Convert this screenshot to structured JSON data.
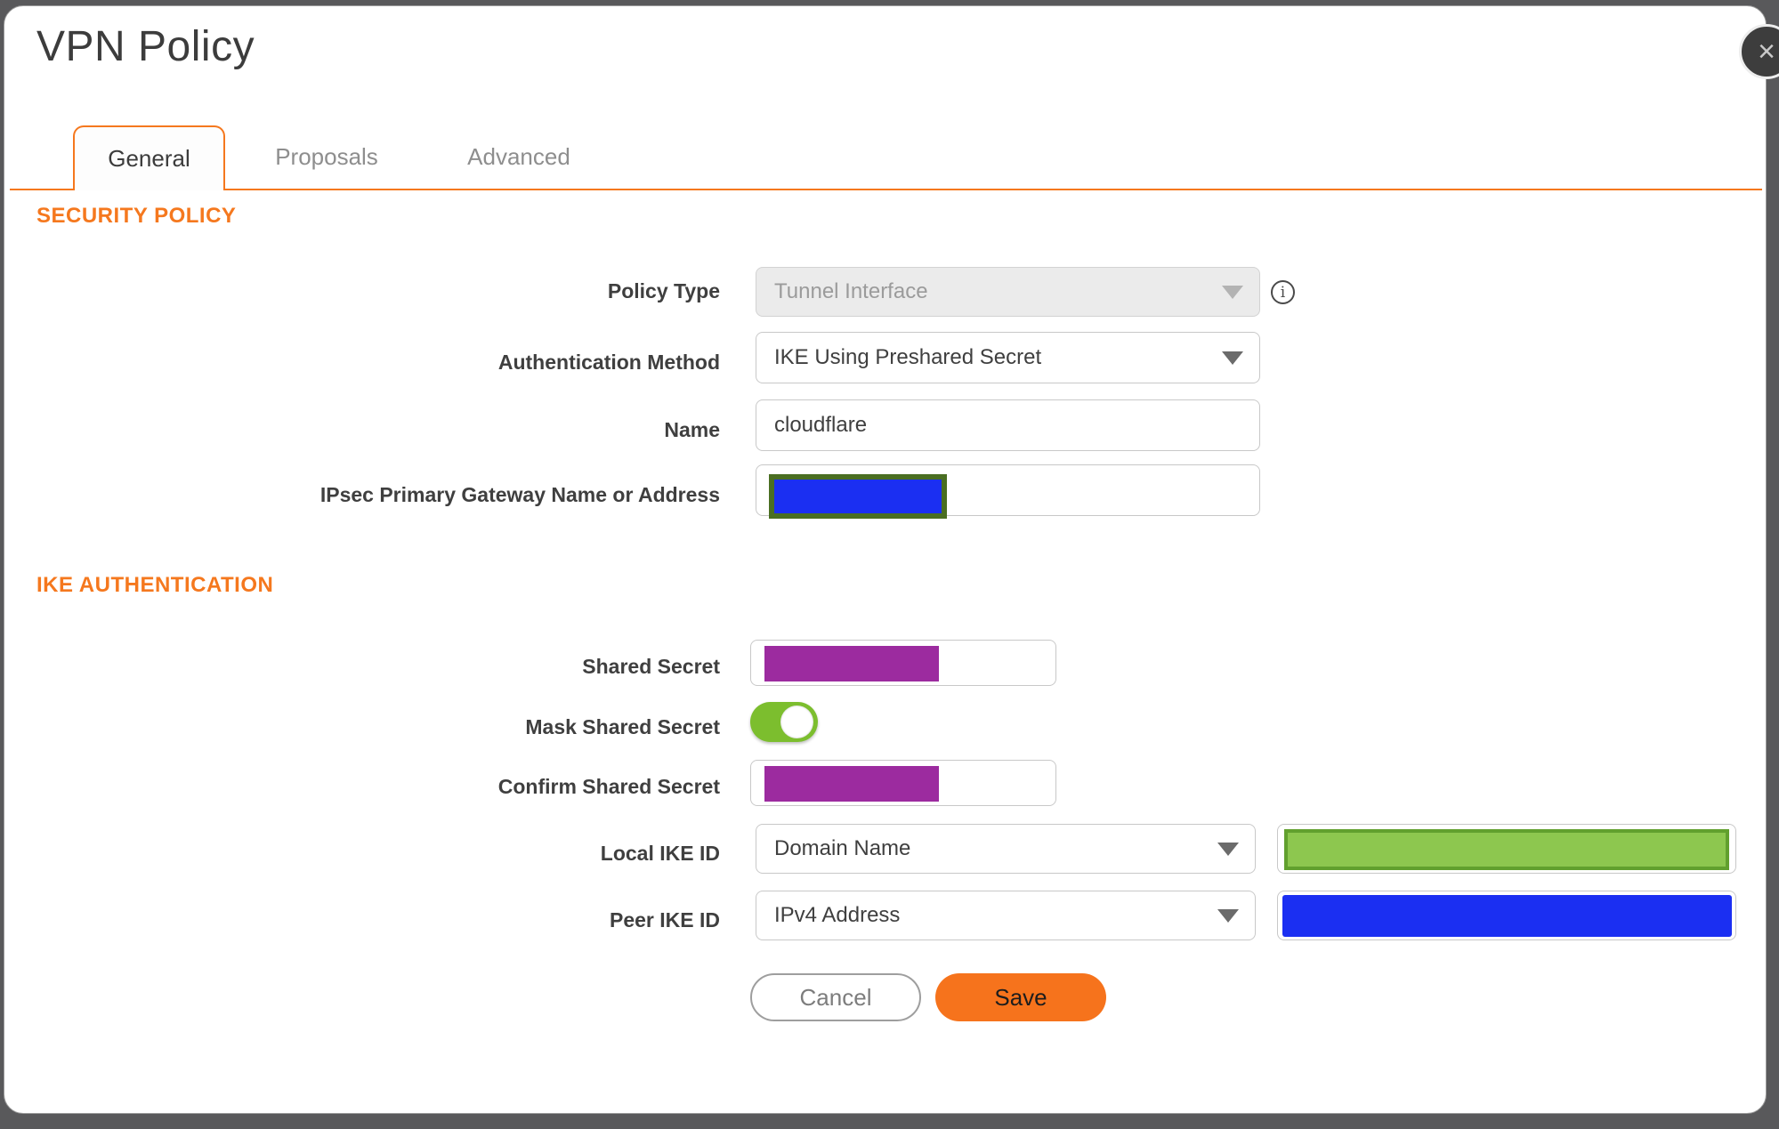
{
  "window": {
    "title": "VPN Policy",
    "close_icon": "×"
  },
  "tabs": [
    {
      "label": "General",
      "active": true
    },
    {
      "label": "Proposals",
      "active": false
    },
    {
      "label": "Advanced",
      "active": false
    }
  ],
  "security_policy": {
    "heading": "SECURITY POLICY",
    "policy_type": {
      "label": "Policy Type",
      "value": "Tunnel Interface",
      "disabled": true,
      "info_icon": "i"
    },
    "auth_method": {
      "label": "Authentication Method",
      "value": "IKE Using Preshared Secret"
    },
    "name": {
      "label": "Name",
      "value": "cloudflare"
    },
    "gateway": {
      "label": "IPsec Primary Gateway Name or Address",
      "redacted": true
    }
  },
  "ike_authentication": {
    "heading": "IKE AUTHENTICATION",
    "shared_secret": {
      "label": "Shared Secret",
      "redacted": true
    },
    "mask_shared_secret": {
      "label": "Mask Shared Secret",
      "state": "on"
    },
    "confirm_shared_secret": {
      "label": "Confirm Shared Secret",
      "redacted": true
    },
    "local_ike_id": {
      "label": "Local IKE ID",
      "value": "Domain Name",
      "id_redacted": true
    },
    "peer_ike_id": {
      "label": "Peer IKE ID",
      "value": "IPv4 Address",
      "id_redacted": true
    }
  },
  "actions": {
    "cancel": "Cancel",
    "save": "Save"
  },
  "colors": {
    "accent": "#f5781e",
    "save_orange": "#f6731c",
    "redact_purple": "#9c2b9f",
    "redact_blue": "#1b2ff2",
    "redact_green": "#8dc74f",
    "redact_green_border": "#61a02e",
    "redact_olive_border": "#4a6e22",
    "toggle_green": "#7cbe2e",
    "backdrop": "#59595b"
  }
}
